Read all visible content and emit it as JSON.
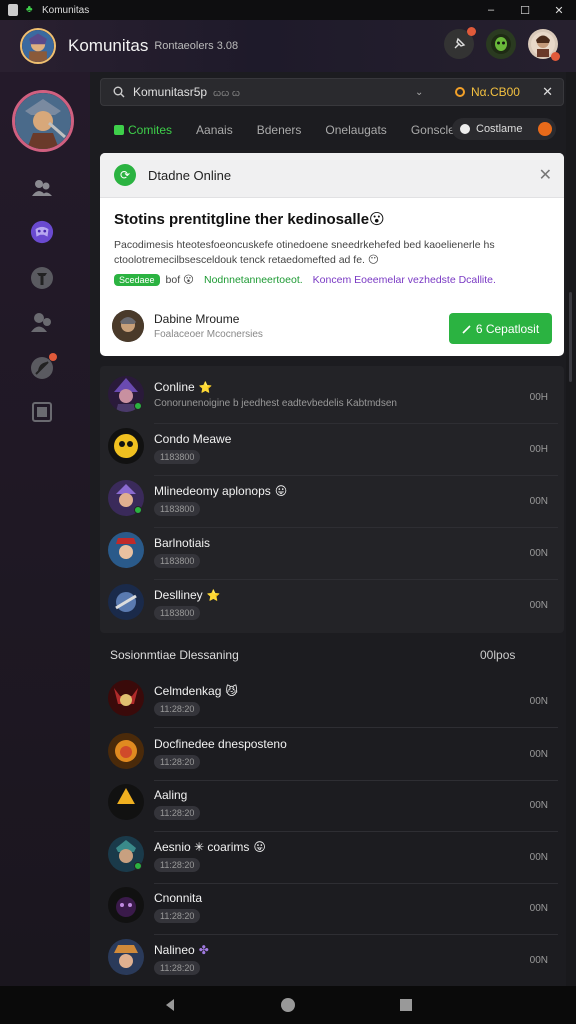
{
  "titlebar": {
    "app_name": "Komunitas",
    "minimize": "–",
    "maximize": "☐",
    "close": "✕"
  },
  "header": {
    "title": "Komunitas",
    "subtitle": "Rontaeolers 3.08"
  },
  "search": {
    "query": "Komunitasr5p",
    "hint": "ꞷꞷ ꞷ",
    "status": "Nα.CB00"
  },
  "tabs": [
    {
      "label": "Comites"
    },
    {
      "label": "Aanais"
    },
    {
      "label": "Bdeners"
    },
    {
      "label": "Onelaugats"
    },
    {
      "label": "Gonscles"
    }
  ],
  "tab_toggle": {
    "label": "Costlame"
  },
  "card": {
    "header_title": "Dtadne Online",
    "headline": "Stotins prentitgline ther kedinosalle😮",
    "paragraph": "Pacodimesis hteotesfoeoncuskefe otinedoene sneedrkehefed bed kaoelienerle hs ctoolotremecilbsesceldouk tenck retaedomefted ad fe. 😶",
    "tag_pill": "Scedaee",
    "tag_2": "bof 😮",
    "tag_3": "Nodnnetanneertoeot.",
    "tag_4": "Koncem Eoeemelar vezhedste Dcallite.",
    "user_name": "Dabine Mroume",
    "user_sub": "Foalaceoer Mcocnersies",
    "button_label": "6 Cepatlosit"
  },
  "friends": [
    {
      "name": "Conline",
      "suffix": "⭐",
      "sub": "Conorunenoigine b jeedhest eadtevbedelis Kabtmdsen",
      "right": "00H"
    },
    {
      "name": "Condo Meawe",
      "suffix": "",
      "sub": "1183800",
      "right": "00H"
    },
    {
      "name": "Mlinedeomy aplonops",
      "suffix": "😛",
      "sub": "1183800",
      "right": "00N"
    },
    {
      "name": "Barlnotiais",
      "suffix": "",
      "sub": "1183800",
      "right": "00N"
    },
    {
      "name": "Deslliney",
      "suffix": "⭐",
      "sub": "1183800",
      "right": "00N"
    }
  ],
  "section2": {
    "title": "Sosionmtiae Dlessaning",
    "right": "00lpos"
  },
  "list2": [
    {
      "name": "Celmdenkag",
      "suffix": "😼",
      "sub": "11:28:20",
      "right": "00N"
    },
    {
      "name": "Docfinedee dnesposteno",
      "suffix": "",
      "sub": "11:28:20",
      "right": "00N"
    },
    {
      "name": "Aaling",
      "suffix": "",
      "sub": "11:28:20",
      "right": "00N"
    },
    {
      "name": "Aesnio ✳ coarims",
      "suffix": "😛",
      "sub": "11:28:20",
      "right": "00N"
    },
    {
      "name": "Cnonnita",
      "suffix": "",
      "sub": "11:28:20",
      "right": "00N"
    },
    {
      "name": "Nalineo",
      "suffix": "✤",
      "sub": "11:28:20",
      "right": "00N"
    }
  ],
  "icons": {
    "header_right": [
      "pin-icon",
      "alien-avatar-icon",
      "profile-avatar-icon"
    ],
    "rail": [
      "users-icon",
      "discord-icon",
      "info-icon",
      "group-icon",
      "feather-icon",
      "gallery-icon"
    ],
    "nav": [
      "back-icon",
      "home-icon",
      "recents-icon"
    ]
  },
  "colors": {
    "accent_green": "#2bb341",
    "warning_orange": "#e86a1a",
    "gold": "#f2c040"
  }
}
